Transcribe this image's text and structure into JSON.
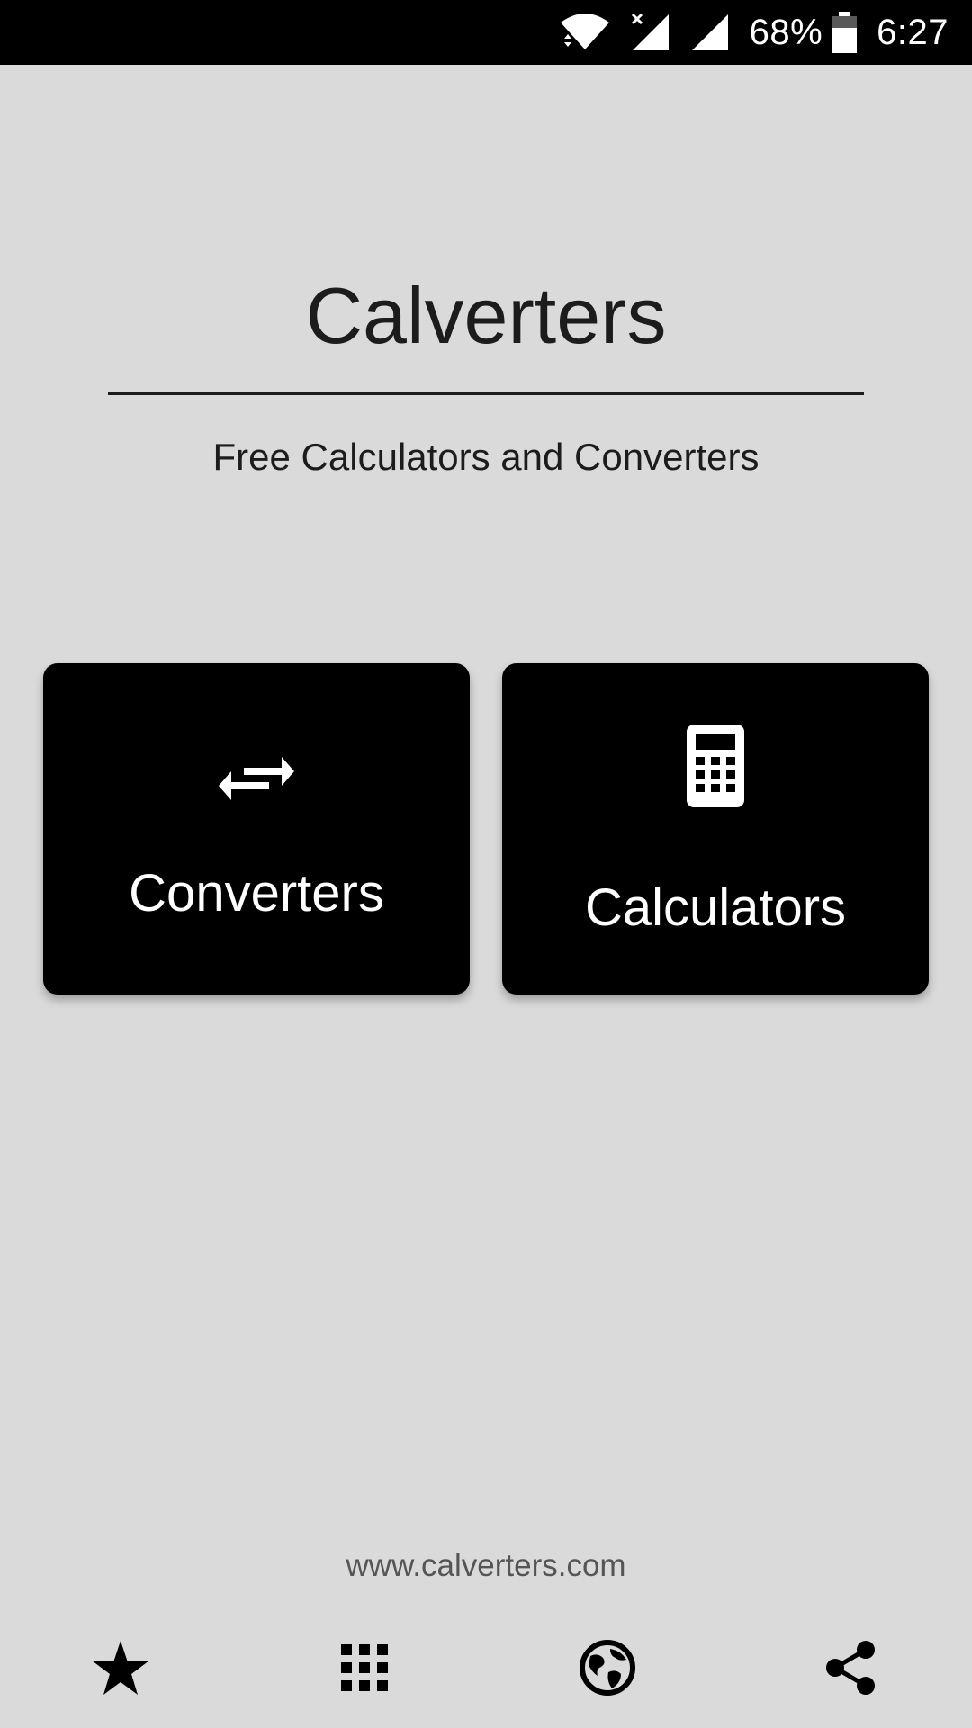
{
  "status_bar": {
    "battery_percent": "68%",
    "time": "6:27",
    "icons": [
      "wifi-icon",
      "signal-no-sim-icon",
      "signal-icon",
      "battery-icon"
    ]
  },
  "header": {
    "title": "Calverters",
    "subtitle": "Free Calculators and Converters"
  },
  "cards": [
    {
      "label": "Converters",
      "icon": "swap-arrows-icon"
    },
    {
      "label": "Calculators",
      "icon": "calculator-icon"
    }
  ],
  "footer": {
    "website": "www.calverters.com",
    "nav_icons": [
      "star-icon",
      "apps-grid-icon",
      "globe-icon",
      "share-icon"
    ]
  },
  "colors": {
    "background": "#dadada",
    "card": "#000000",
    "card_text": "#ffffff",
    "text": "#1c1c1c",
    "link": "#555555"
  }
}
